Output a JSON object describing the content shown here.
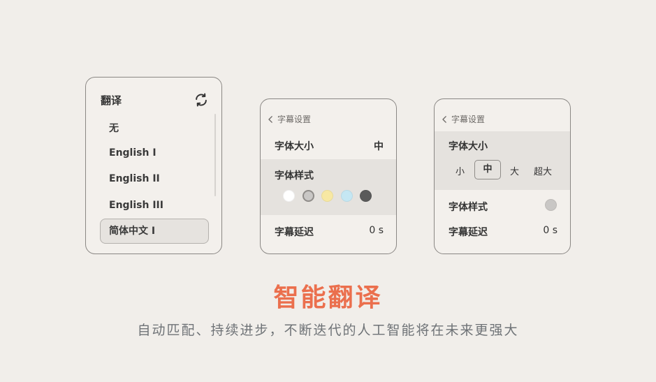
{
  "translate_panel": {
    "title": "翻译",
    "items": [
      "无",
      "English I",
      "English II",
      "English III"
    ],
    "selected_item": "简体中文 I"
  },
  "subtitle_panel_a": {
    "back_label": "字幕设置",
    "font_size_label": "字体大小",
    "font_size_value": "中",
    "font_style_label": "字体样式",
    "style_colors": [
      "#ffffff",
      "#c9c7c5",
      "#f7e8a3",
      "#c5e7f3",
      "#5a5a5a"
    ],
    "selected_color": "#c9c7c5",
    "delay_label": "字幕延迟",
    "delay_value": "0 s"
  },
  "subtitle_panel_b": {
    "back_label": "字幕设置",
    "font_size_label": "字体大小",
    "size_options": [
      "小",
      "中",
      "大",
      "超大"
    ],
    "selected_size": "中",
    "font_style_label": "字体样式",
    "current_color": "#c9c7c5",
    "delay_label": "字幕延迟",
    "delay_value": "0 s"
  },
  "headline": "智能翻译",
  "subline": "自动匹配、持续进步，不断迭代的人工智能将在未来更强大",
  "colors": {
    "accent": "#eb6f4d",
    "background": "#f1eeea",
    "panel_border": "#8a8784"
  }
}
